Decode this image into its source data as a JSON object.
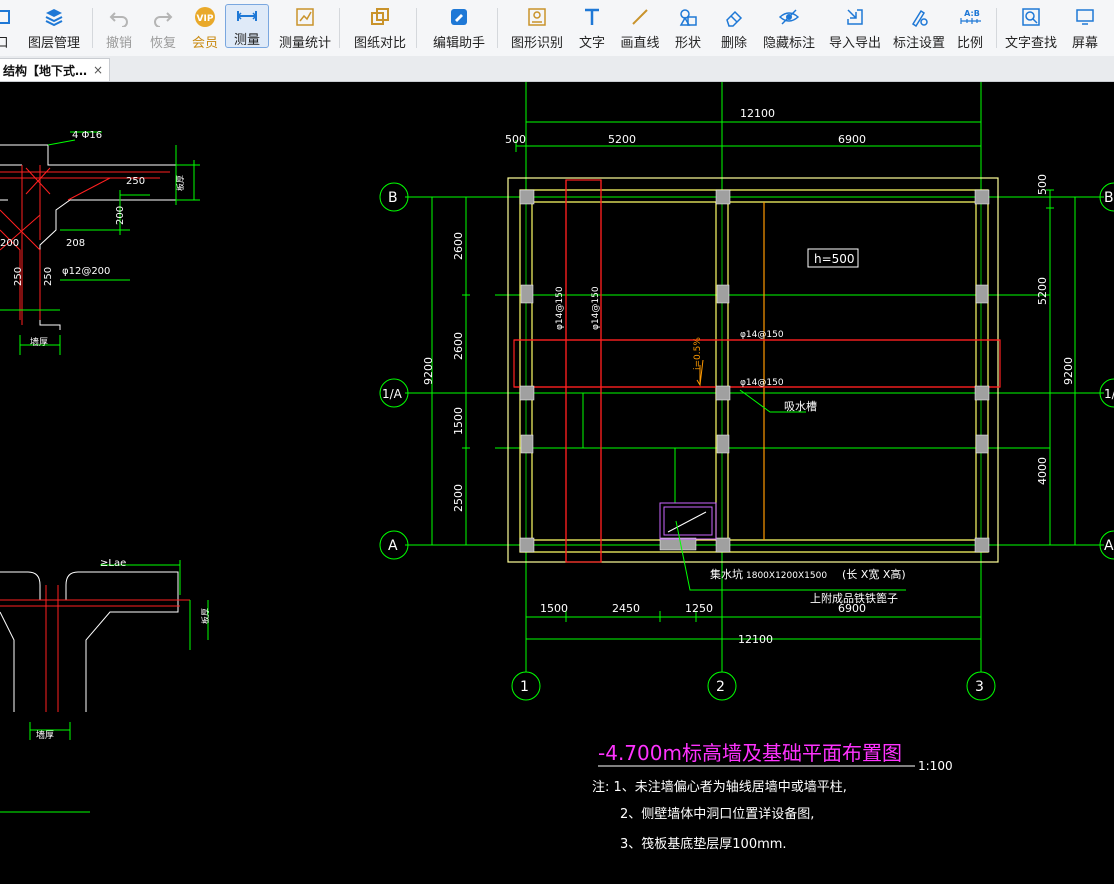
{
  "toolbar": {
    "items": [
      {
        "label": "口",
        "icon": "window-icon"
      },
      {
        "label": "图层管理",
        "icon": "layers-icon"
      },
      {
        "label": "撤销",
        "icon": "undo-icon"
      },
      {
        "label": "恢复",
        "icon": "redo-icon"
      },
      {
        "label": "会员",
        "icon": "vip-icon",
        "badge": "VIP"
      },
      {
        "label": "测量",
        "icon": "measure-icon"
      },
      {
        "label": "测量统计",
        "icon": "measure-stats-icon"
      },
      {
        "label": "图纸对比",
        "icon": "compare-icon"
      },
      {
        "label": "编辑助手",
        "icon": "edit-assistant-icon"
      },
      {
        "label": "图形识别",
        "icon": "shape-recognition-icon"
      },
      {
        "label": "文字",
        "icon": "text-icon"
      },
      {
        "label": "画直线",
        "icon": "line-icon"
      },
      {
        "label": "形状",
        "icon": "shapes-icon"
      },
      {
        "label": "删除",
        "icon": "eraser-icon"
      },
      {
        "label": "隐藏标注",
        "icon": "eye-hide-icon"
      },
      {
        "label": "导入导出",
        "icon": "import-export-icon"
      },
      {
        "label": "标注设置",
        "icon": "annotation-settings-icon"
      },
      {
        "label": "比例",
        "icon": "scale-icon",
        "badge": "A:B"
      },
      {
        "label": "文字查找",
        "icon": "text-search-icon"
      },
      {
        "label": "屏幕",
        "icon": "screen-icon"
      }
    ]
  },
  "tab": {
    "title": "结构【地下式…",
    "close": "×"
  },
  "drawing": {
    "colors": {
      "grid": "#00ff00",
      "wall": "#ffff66",
      "rebar": "#ff2020",
      "white": "#ffffff",
      "title": "#ff33ff",
      "toolbar_accent": "#1e78d6"
    },
    "top_dims": {
      "total": "12100",
      "d1": "500",
      "d2": "5200",
      "d3": "6900"
    },
    "bottom_dims": {
      "total": "12100",
      "d1": "1500",
      "d2": "2450",
      "d3": "1250",
      "d4": "6900"
    },
    "left_dims": {
      "total": "9200",
      "d1": "2600",
      "d2": "2600",
      "d3": "1500",
      "d4": "2500"
    },
    "right_dims": {
      "total": "9200",
      "d1": "500",
      "d2": "5200",
      "d3": "4000"
    },
    "axes": {
      "col1": "1",
      "col2": "2",
      "col3": "3",
      "rowB": "B",
      "rowA1": "1/A",
      "rowA": "A"
    },
    "labels": {
      "h500": "h=500",
      "rebar1": "φ14@150",
      "rebar2": "φ14@150",
      "rebar3": "φ14@150",
      "rebar4": "φ14@150",
      "slope": "i=0.5%",
      "trench": "吸水槽",
      "pit": "集水坑",
      "pit_size": "1800X1200X1500",
      "pit_dims": "(长 X宽 X高)",
      "pit_note": "上附成品铁铁篦子"
    },
    "title": "-4.700m标高墙及基础平面布置图",
    "scale": "1:100",
    "notes": [
      "注: 1、未注墙偏心者为轴线居墙中或墙平柱,",
      "2、侧壁墙体中洞口位置详设备图,",
      "3、筏板基底垫层厚100mm."
    ],
    "detail_top": {
      "rebar": "4 Φ16",
      "d250": "250",
      "d200": "200",
      "d200b": "200",
      "d208": "208",
      "d250b": "250",
      "d250c": "250",
      "stirrup": "φ12@200",
      "wall": "墙厚",
      "beam": "板厚"
    },
    "detail_bottom": {
      "lae": "≥Lae",
      "wall": "墙厚",
      "beam": "板厚"
    }
  }
}
